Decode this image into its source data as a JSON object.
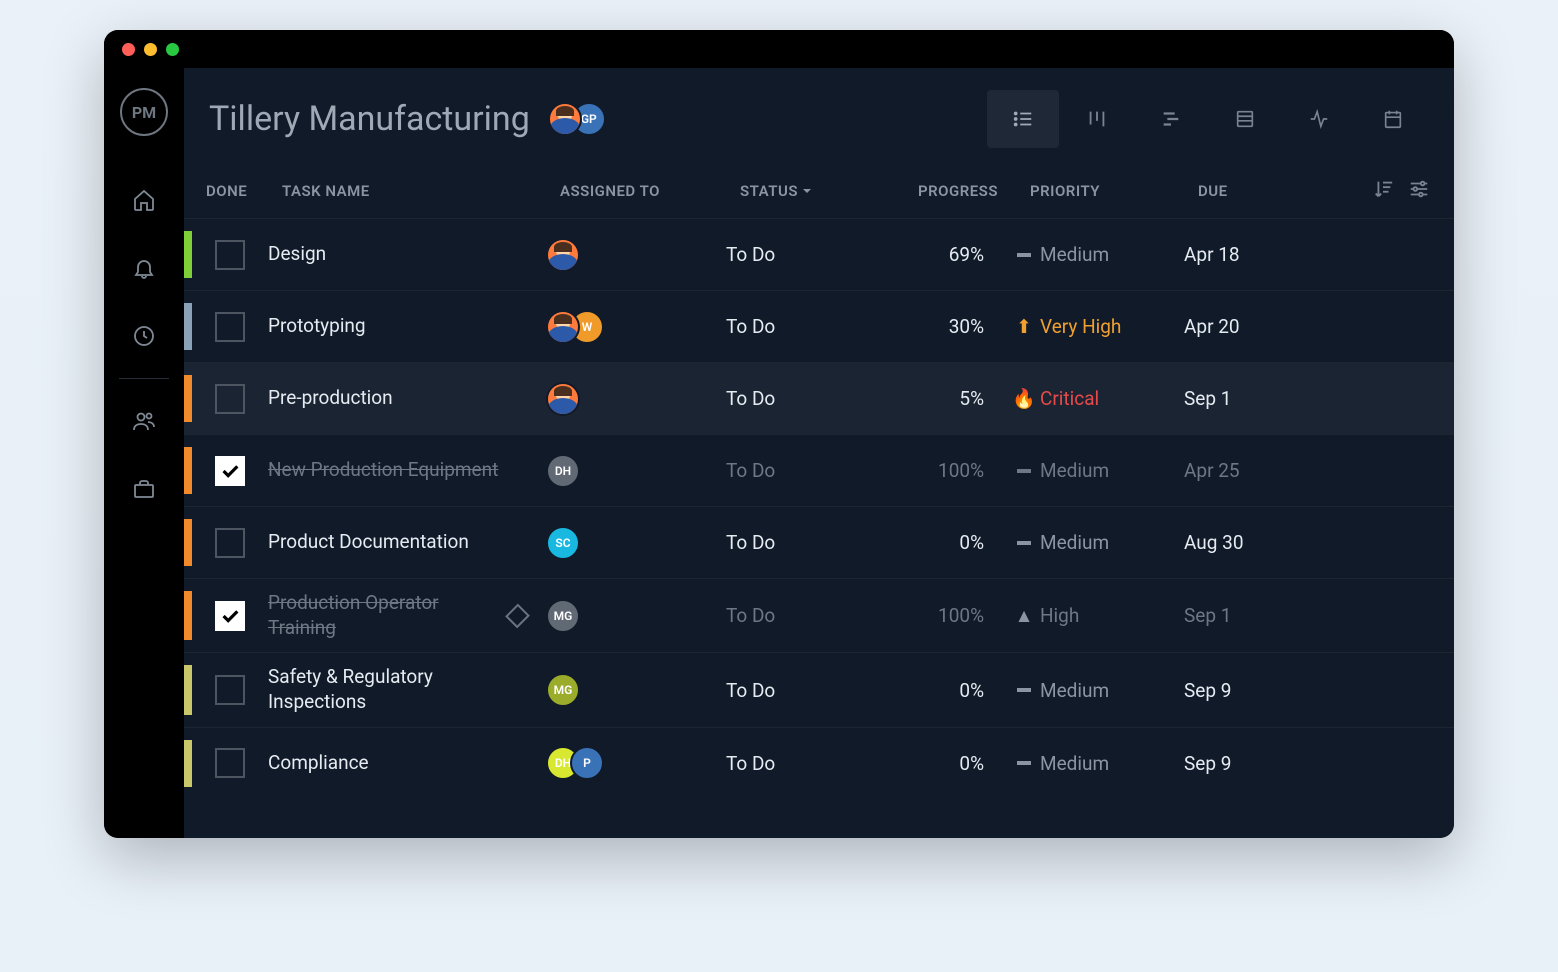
{
  "header": {
    "title": "Tillery Manufacturing",
    "logo_text": "PM",
    "avatars": [
      {
        "type": "person",
        "bg": "#ff7a3d"
      },
      {
        "type": "initials",
        "initials": "GP",
        "bg": "#3a72b8"
      }
    ]
  },
  "columns": {
    "done": "DONE",
    "task": "TASK NAME",
    "assigned": "ASSIGNED TO",
    "status": "STATUS",
    "progress": "PROGRESS",
    "priority": "PRIORITY",
    "due": "DUE"
  },
  "priority_labels": {
    "medium": "Medium",
    "very_high": "Very High",
    "critical": "Critical",
    "high": "High"
  },
  "tasks": [
    {
      "color": "#7fd038",
      "done": false,
      "name": "Design",
      "avatars": [
        {
          "type": "person",
          "bg": "#ff7a3d"
        }
      ],
      "status": "To Do",
      "progress": "69%",
      "priority": "medium",
      "due": "Apr 18",
      "highlight": false,
      "milestone": false
    },
    {
      "color": "#8aa2b8",
      "done": false,
      "name": "Prototyping",
      "avatars": [
        {
          "type": "person",
          "bg": "#ff7a3d"
        },
        {
          "type": "initials",
          "initials": "W",
          "bg": "#f09a2a"
        }
      ],
      "status": "To Do",
      "progress": "30%",
      "priority": "very_high",
      "due": "Apr 20",
      "highlight": false,
      "milestone": false
    },
    {
      "color": "#f08a2a",
      "done": false,
      "name": "Pre-production",
      "avatars": [
        {
          "type": "person",
          "bg": "#ff7a3d"
        }
      ],
      "status": "To Do",
      "progress": "5%",
      "priority": "critical",
      "due": "Sep 1",
      "highlight": true,
      "milestone": false
    },
    {
      "color": "#f08a2a",
      "done": true,
      "name": "New Production Equipment",
      "avatars": [
        {
          "type": "initials",
          "initials": "DH",
          "bg": "#616a74"
        }
      ],
      "status": "To Do",
      "progress": "100%",
      "priority": "medium",
      "due": "Apr 25",
      "highlight": false,
      "milestone": false
    },
    {
      "color": "#f08a2a",
      "done": false,
      "name": "Product Documentation",
      "avatars": [
        {
          "type": "initials",
          "initials": "SC",
          "bg": "#18b8e0"
        }
      ],
      "status": "To Do",
      "progress": "0%",
      "priority": "medium",
      "due": "Aug 30",
      "highlight": false,
      "milestone": false
    },
    {
      "color": "#f08a2a",
      "done": true,
      "name": "Production Operator Training",
      "avatars": [
        {
          "type": "initials",
          "initials": "MG",
          "bg": "#616a74"
        }
      ],
      "status": "To Do",
      "progress": "100%",
      "priority": "high",
      "due": "Sep 1",
      "highlight": false,
      "milestone": true
    },
    {
      "color": "#c8c86a",
      "done": false,
      "name": "Safety & Regulatory Inspections",
      "avatars": [
        {
          "type": "initials",
          "initials": "MG",
          "bg": "#9aac2a"
        }
      ],
      "status": "To Do",
      "progress": "0%",
      "priority": "medium",
      "due": "Sep 9",
      "highlight": false,
      "milestone": false
    },
    {
      "color": "#c8c86a",
      "done": false,
      "name": "Compliance",
      "avatars": [
        {
          "type": "initials",
          "initials": "DH",
          "bg": "#d8e830"
        },
        {
          "type": "initials",
          "initials": "P",
          "bg": "#3a72b8"
        }
      ],
      "status": "To Do",
      "progress": "0%",
      "priority": "medium",
      "due": "Sep 9",
      "highlight": false,
      "milestone": false
    }
  ]
}
